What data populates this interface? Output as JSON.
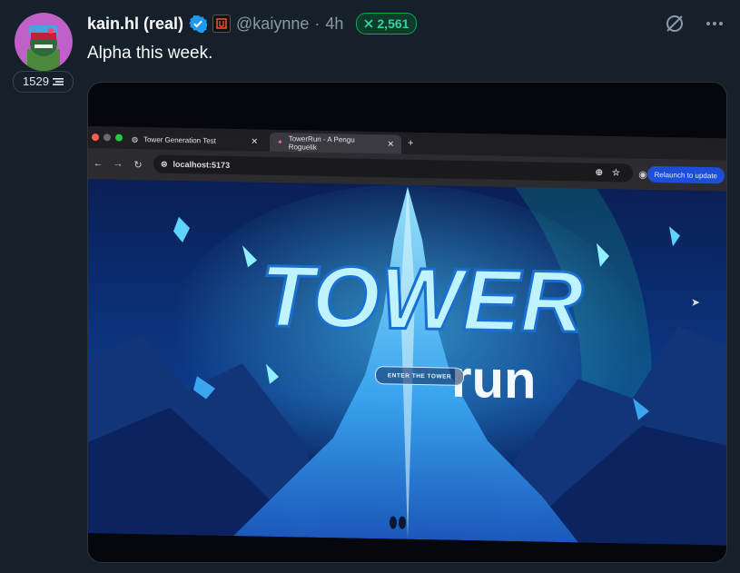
{
  "author": {
    "display_name": "kain.hl (real)",
    "handle": "@kaiynne",
    "time": "4h",
    "dot": "·",
    "score": "1529",
    "pill_value": "2,561"
  },
  "tweet": {
    "text": "Alpha this week."
  },
  "browser": {
    "tab1_title": "Tower Generation Test",
    "tab2_title": "TowerRun - A Pengu Roguelik",
    "url": "localhost:5173",
    "relaunch_label": "Relaunch to update"
  },
  "game": {
    "logo_word1": "TOWER",
    "logo_word2": "run",
    "enter_button": "ENTER THE TOWER"
  },
  "colors": {
    "background": "#15202b",
    "verified": "#1d9bf0",
    "pill_green": "#34d399",
    "relaunch_blue": "#1d4ed8"
  },
  "icons": [
    "verified-icon",
    "affiliate-icon",
    "grok-icon",
    "more-icon",
    "close-icon",
    "plus-icon",
    "back-icon",
    "forward-icon",
    "reload-icon",
    "zoom-icon",
    "star-icon",
    "profile-icon"
  ]
}
